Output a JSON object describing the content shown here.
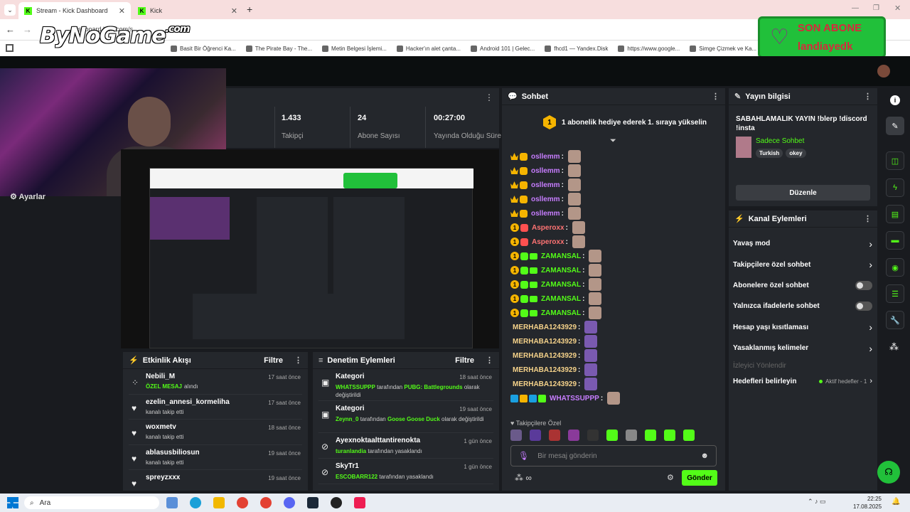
{
  "browser": {
    "tabs": [
      {
        "label": "Stream - Kick Dashboard"
      },
      {
        "label": "Kick"
      }
    ],
    "url": "dashboard.kick.com/s...",
    "bookmarks": [
      "Basit Bir Öğrenci Ka...",
      "The Pirate Bay - The...",
      "Metin Belgesi İşlemi...",
      "Hacker'ın alet çanta...",
      "Android 101 | Gelec...",
      "fhcd1 — Yandex.Disk",
      "https://www.google...",
      "Simge Çizmek ve Ka..."
    ]
  },
  "overlay": {
    "logo": "ByNoGame",
    "logo_suffix": ".com",
    "son_abone_title": "SON ABONE",
    "son_abone_name": "landiayedk"
  },
  "left": {
    "settings_label": "Ayarlar"
  },
  "stats": [
    {
      "value": "1.433",
      "label": "Takipçi"
    },
    {
      "value": "24",
      "label": "Abone Sayısı"
    },
    {
      "value": "00:27:00",
      "label": "Yayında Olduğu Süre"
    }
  ],
  "activity": {
    "title": "Etkinlik Akışı",
    "filter": "Filtre",
    "items": [
      {
        "name": "Nebili_M",
        "action_em": "ÖZEL MESAJ",
        "action": "alındı",
        "time": "17 saat önce"
      },
      {
        "name": "ezelin_annesi_kormeliha",
        "action_em": "",
        "action": "kanalı takip etti",
        "time": "17 saat önce"
      },
      {
        "name": "woxmetv",
        "action_em": "",
        "action": "kanalı takip etti",
        "time": "18 saat önce"
      },
      {
        "name": "ablasusbiliosun",
        "action_em": "",
        "action": "kanalı takip etti",
        "time": "19 saat önce"
      },
      {
        "name": "spreyzxxx",
        "action_em": "",
        "action": "",
        "time": "19 saat önce"
      }
    ]
  },
  "moderation": {
    "title": "Denetim Eylemleri",
    "filter": "Filtre",
    "items": [
      {
        "title": "Kategori",
        "user": "WHATSSUPPP",
        "mid": "tarafından",
        "em2": "PUBG: Battlegrounds",
        "end": "olarak değiştirildi",
        "time": "18 saat önce"
      },
      {
        "title": "Kategori",
        "user": "Zeynn_0",
        "mid": "tarafından",
        "em2": "Goose Goose Duck",
        "end": "olarak değiştirildi",
        "time": "19 saat önce"
      },
      {
        "title": "Ayexnoktaalttantirenokta",
        "user": "turanlandia",
        "mid": "tarafından yasaklandı",
        "em2": "",
        "end": "",
        "time": "1 gün önce"
      },
      {
        "title": "SkyTr1",
        "user": "ESCOBARR122",
        "mid": "tarafından yasaklandı",
        "em2": "",
        "end": "",
        "time": "1 gün önce"
      }
    ]
  },
  "chat": {
    "title": "Sohbet",
    "banner": "1 abonelik hediye ederek 1. sıraya yükselin",
    "banner_num": "1",
    "lines": [
      {
        "user": "osllemm",
        "color": "#c77dff",
        "badge": "crown"
      },
      {
        "user": "osllemm",
        "color": "#c77dff",
        "badge": "crown"
      },
      {
        "user": "osllemm",
        "color": "#c77dff",
        "badge": "crown"
      },
      {
        "user": "osllemm",
        "color": "#c77dff",
        "badge": "crown"
      },
      {
        "user": "osllemm",
        "color": "#c77dff",
        "badge": "crown"
      },
      {
        "user": "Asperoxx",
        "color": "#ff7373",
        "badge": "one"
      },
      {
        "user": "Asperoxx",
        "color": "#ff7373",
        "badge": "one"
      },
      {
        "user": "ZAMANSAL",
        "color": "#53fc18",
        "badge": "one"
      },
      {
        "user": "ZAMANSAL",
        "color": "#53fc18",
        "badge": "one"
      },
      {
        "user": "ZAMANSAL",
        "color": "#53fc18",
        "badge": "one"
      },
      {
        "user": "ZAMANSAL",
        "color": "#53fc18",
        "badge": "one"
      },
      {
        "user": "ZAMANSAL",
        "color": "#53fc18",
        "badge": "one"
      },
      {
        "user": "MERHABA1243929",
        "color": "#f5d28a",
        "badge": "none"
      },
      {
        "user": "MERHABA1243929",
        "color": "#f5d28a",
        "badge": "none"
      },
      {
        "user": "MERHABA1243929",
        "color": "#f5d28a",
        "badge": "none"
      },
      {
        "user": "MERHABA1243929",
        "color": "#f5d28a",
        "badge": "none"
      },
      {
        "user": "MERHABA1243929",
        "color": "#f5d28a",
        "badge": "none"
      },
      {
        "user": "WHATSSUPPP",
        "color": "#c77dff",
        "badge": "multi"
      }
    ],
    "followers_only": "Takipçilere Özel",
    "input_placeholder": "Bir mesaj gönderin",
    "send": "Gönder"
  },
  "stream_info": {
    "title": "Yayın bilgisi",
    "stream_title": "SABAHLAMALIK YAYIN !blerp !discord !insta",
    "category": "Sadece Sohbet",
    "tags": [
      "Turkish",
      "okey"
    ],
    "edit": "Düzenle"
  },
  "channel_actions": {
    "title": "Kanal Eylemleri",
    "items": [
      {
        "label": "Yavaş mod",
        "control": "chevron"
      },
      {
        "label": "Takipçilere özel sohbet",
        "control": "chevron"
      },
      {
        "label": "Abonelere özel sohbet",
        "control": "toggle"
      },
      {
        "label": "Yalnızca ifadelerle sohbet",
        "control": "toggle"
      },
      {
        "label": "Hesap yaşı kısıtlaması",
        "control": "chevron"
      },
      {
        "label": "Yasaklanmış kelimeler",
        "control": "chevron"
      }
    ],
    "viewer_redirect": "İzleyici Yönlendir",
    "goals": "Hedefleri belirleyin",
    "goals_status": "Aktif hedefler - 1"
  },
  "taskbar": {
    "search": "Ara",
    "time": "22:25",
    "date": "17.08.2025"
  },
  "colors": {
    "accent": "#53fc18",
    "bg": "#191b1f",
    "panel": "#24272c"
  }
}
